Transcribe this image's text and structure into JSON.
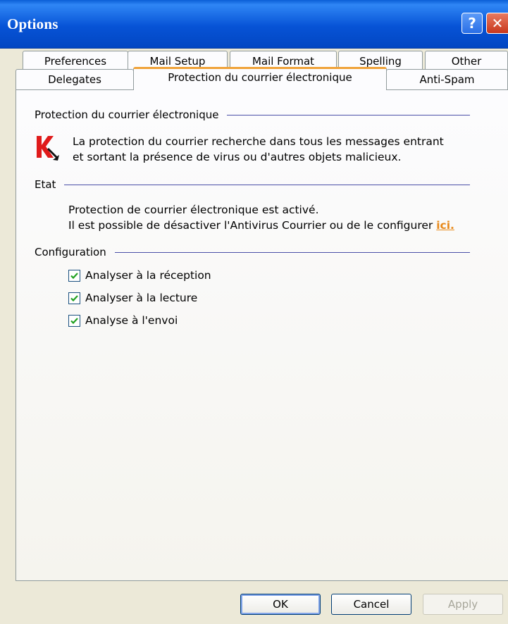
{
  "window": {
    "title": "Options"
  },
  "titlebar": {
    "help_symbol": "?",
    "close_symbol": "✕"
  },
  "tabs": {
    "row1": [
      "Preferences",
      "Mail Setup",
      "Mail Format",
      "Spelling",
      "Other"
    ],
    "row2": [
      "Delegates",
      "Protection du courrier électronique",
      "Anti-Spam"
    ],
    "active": "Protection du courrier électronique"
  },
  "protection": {
    "header": "Protection du courrier électronique",
    "line1": "La protection du courrier recherche dans tous les messages entrant",
    "line2": "et sortant la présence de virus ou d'autres objets malicieux."
  },
  "state": {
    "header": "Etat",
    "line1": "Protection de courrier électronique est activé.",
    "line2": "Il est possible de désactiver l'Antivirus Courrier ou de le configurer",
    "link": "ici."
  },
  "config": {
    "header": "Configuration",
    "options": [
      {
        "label": "Analyser à la réception",
        "checked": true
      },
      {
        "label": "Analyser à la lecture",
        "checked": true
      },
      {
        "label": "Analyse à l'envoi",
        "checked": true
      }
    ]
  },
  "buttons": {
    "ok": "OK",
    "cancel": "Cancel",
    "apply": "Apply"
  },
  "icons": {
    "logo": "kaspersky-k-logo-icon",
    "check": "checkmark-icon"
  },
  "colors": {
    "titlebar": "#0753d6",
    "active_tab_accent": "#f0a238",
    "link": "#e8891a",
    "divider": "#4a4fa8",
    "logo_red": "#e01b1b"
  }
}
